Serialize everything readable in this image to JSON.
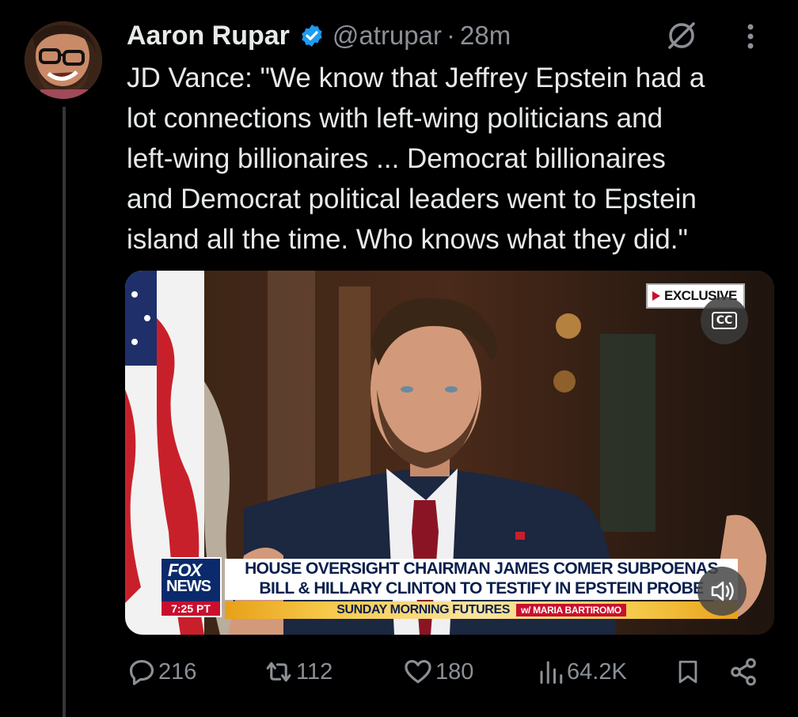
{
  "tweet": {
    "author_name": "Aaron Rupar",
    "handle": "@atrupar",
    "separator": "·",
    "time": "28m",
    "text": "JD Vance: \"We know that Jeffrey Epstein had a\nlot connections with left-wing politicians and\nleft-wing billionaires ... Democrat billionaires\nand Democrat political leaders went to Epstein\nisland all the time. Who knows what they did.\""
  },
  "video": {
    "exclusive_label": "EXCLUSIVE",
    "cc_label": "CC",
    "network_top": "FOX",
    "network_bottom": "NEWS",
    "clock": "7:25 PT",
    "headline_line1": "HOUSE OVERSIGHT CHAIRMAN JAMES COMER SUBPOENAS",
    "headline_line2": "BILL & HILLARY CLINTON TO TESTIFY IN EPSTEIN PROBE",
    "show_name": "SUNDAY MORNING FUTURES",
    "host": "w/ MARIA BARTIROMO"
  },
  "actions": {
    "replies": "216",
    "reposts": "112",
    "likes": "180",
    "views": "64.2K"
  },
  "icons": {
    "verified": "verified-badge-icon",
    "grok": "grok-icon",
    "more": "more-dots-icon",
    "reply": "reply-bubble-icon",
    "repost": "repost-arrows-icon",
    "like": "heart-icon",
    "views": "bar-chart-icon",
    "bookmark": "bookmark-icon",
    "share": "share-icon",
    "mute": "speaker-icon"
  },
  "colors": {
    "background": "#000000",
    "text": "#e7e9ea",
    "muted": "#8b9096",
    "verified_blue": "#1d9bf0",
    "fox_red": "#c8102e",
    "fox_navy": "#0b2a6b"
  }
}
